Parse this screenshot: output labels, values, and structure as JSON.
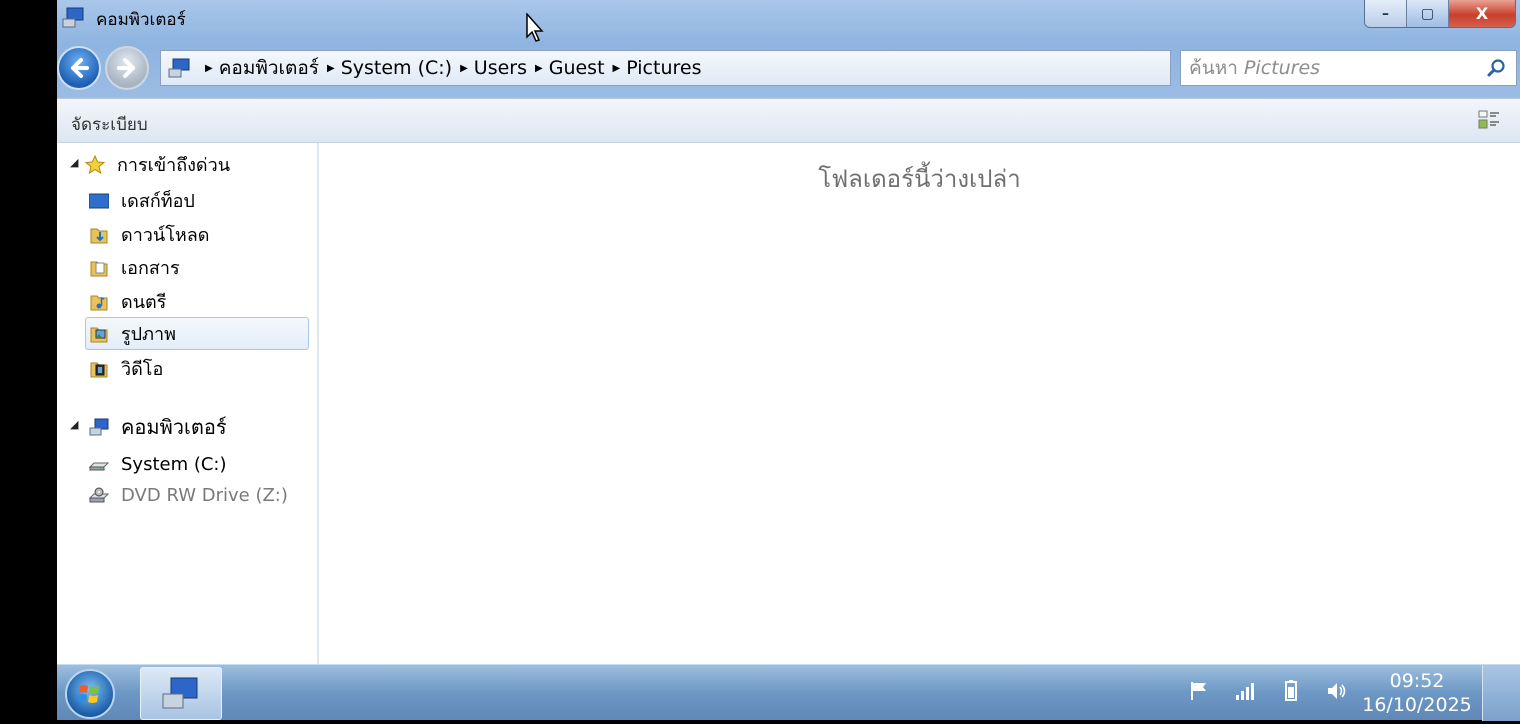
{
  "window": {
    "title": "คอมพิวเตอร์",
    "buttons": {
      "minimize": "–",
      "maximize": "▢",
      "close": "X"
    }
  },
  "address": {
    "crumbs": [
      "คอมพิวเตอร์",
      "System (C:)",
      "Users",
      "Guest",
      "Pictures"
    ]
  },
  "search": {
    "prefix": "ค้นหา",
    "scope": "Pictures"
  },
  "toolbar": {
    "organize_label": "จัดระเบียบ"
  },
  "navpane": {
    "favorites_label": "การเข้าถึงด่วน",
    "favorites": [
      {
        "label": "เดสก์ท็อป",
        "icon": "desktop-icon"
      },
      {
        "label": "ดาวน์โหลด",
        "icon": "downloads-folder-icon"
      },
      {
        "label": "เอกสาร",
        "icon": "documents-folder-icon"
      },
      {
        "label": "ดนตรี",
        "icon": "music-folder-icon"
      },
      {
        "label": "รูปภาพ",
        "icon": "pictures-folder-icon",
        "selected": true
      },
      {
        "label": "วิดีโอ",
        "icon": "videos-folder-icon"
      }
    ],
    "computer_label": "คอมพิวเตอร์",
    "drives": [
      {
        "label": "System (C:)",
        "icon": "hard-drive-icon"
      },
      {
        "label": "DVD RW Drive (Z:)",
        "icon": "dvd-drive-icon",
        "disabled": true
      }
    ]
  },
  "content": {
    "empty_message": "โฟลเดอร์นี้ว่างเปล่า"
  },
  "taskbar": {
    "time": "09:52",
    "date": "16/10/2025"
  },
  "colors": {
    "titlebar": "#9bbce4",
    "taskbar": "#6d97c4",
    "close_button": "#c9402c",
    "selection": "#e3edf9"
  }
}
